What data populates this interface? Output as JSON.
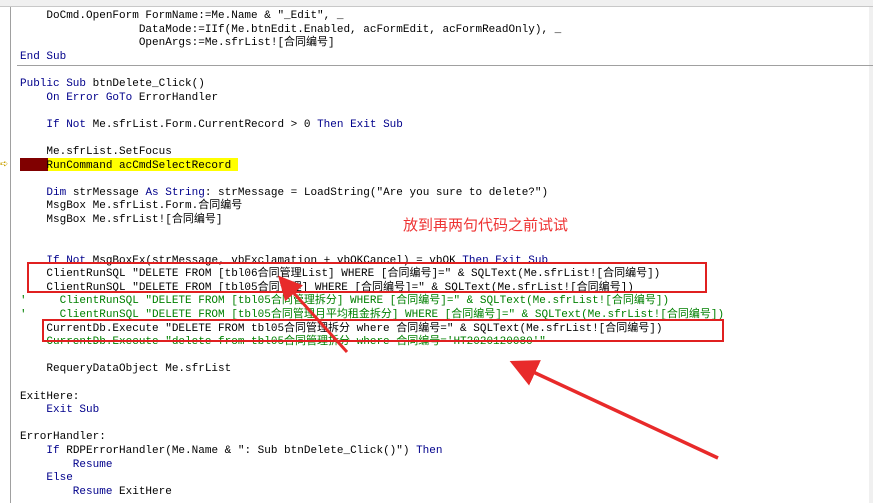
{
  "editor": {
    "lines": [
      [
        {
          "t": "    DoCmd.OpenForm FormName:=Me.Name & \"_Edit\", _",
          "c": "n"
        }
      ],
      [
        {
          "t": "                  DataMode:=IIf(Me.btnEdit.Enabled, acFormEdit, acFormReadOnly), _",
          "c": "n"
        }
      ],
      [
        {
          "t": "                  OpenArgs:=Me.sfrList![合同编号]",
          "c": "n"
        }
      ],
      [
        {
          "t": "End Sub",
          "c": "k"
        }
      ],
      [],
      [
        {
          "t": "Public Sub ",
          "c": "k"
        },
        {
          "t": "btnDelete_Click()",
          "c": "n"
        }
      ],
      [
        {
          "t": "    On Error GoTo ",
          "c": "k"
        },
        {
          "t": "ErrorHandler",
          "c": "n"
        }
      ],
      [],
      [
        {
          "t": "    If Not ",
          "c": "k"
        },
        {
          "t": "Me.sfrList.Form.CurrentRecord > 0 ",
          "c": "n"
        },
        {
          "t": "Then Exit Sub",
          "c": "k"
        }
      ],
      [],
      [
        {
          "t": "    Me.sfrList.SetFocus",
          "c": "n"
        }
      ],
      [
        {
          "t": "    RunCommand acCmdSelectRecord",
          "c": "n"
        }
      ],
      [],
      [
        {
          "t": "    Dim ",
          "c": "k"
        },
        {
          "t": "strMessage ",
          "c": "n"
        },
        {
          "t": "As String",
          "c": "k"
        },
        {
          "t": ": strMessage = LoadString(\"Are you sure to delete?\")",
          "c": "n"
        }
      ],
      [
        {
          "t": "    MsgBox Me.sfrList.Form.合同编号",
          "c": "n"
        }
      ],
      [
        {
          "t": "    MsgBox Me.sfrList![合同编号]",
          "c": "n"
        }
      ],
      [],
      [],
      [
        {
          "t": "    If Not ",
          "c": "k"
        },
        {
          "t": "MsgBoxEx(strMessage, vbExclamation + vbOKCancel) = vbOK ",
          "c": "n"
        },
        {
          "t": "Then Exit Sub",
          "c": "k"
        }
      ],
      [
        {
          "t": "    ClientRunSQL \"DELETE FROM [tbl06合同管理List] WHERE [合同编号]=\" & SQLText(Me.sfrList![合同编号])",
          "c": "n"
        }
      ],
      [
        {
          "t": "    ClientRunSQL \"DELETE FROM [tbl05合同管理] WHERE [合同编号]=\" & SQLText(Me.sfrList![合同编号])",
          "c": "n"
        }
      ],
      [
        {
          "t": "'     ClientRunSQL \"DELETE FROM [tbl05合同管理拆分] WHERE [合同编号]=\" & SQLText(Me.sfrList![合同编号])",
          "c": "c"
        }
      ],
      [
        {
          "t": "'     ClientRunSQL \"DELETE FROM [tbl05合同管理月平均租金拆分] WHERE [合同编号]=\" & SQLText(Me.sfrList![合同编号])",
          "c": "c"
        }
      ],
      [
        {
          "t": "    CurrentDb.Execute \"DELETE FROM tbl05合同管理拆分 where 合同编号=\" & SQLText(Me.sfrList![合同编号])",
          "c": "n"
        }
      ],
      [
        {
          "t": "   'CurrentDb.Execute \"delete from tbl05合同管理拆分 where 合同编号='HT2020120080'\"",
          "c": "c"
        }
      ],
      [],
      [
        {
          "t": "    RequeryDataObject Me.sfrList",
          "c": "n"
        }
      ],
      [],
      [
        {
          "t": "ExitHere:",
          "c": "n"
        }
      ],
      [
        {
          "t": "    Exit Sub",
          "c": "k"
        }
      ],
      [],
      [
        {
          "t": "ErrorHandler:",
          "c": "n"
        }
      ],
      [
        {
          "t": "    If ",
          "c": "k"
        },
        {
          "t": "RDPErrorHandler(Me.Name & \": Sub btnDelete_Click()\") ",
          "c": "n"
        },
        {
          "t": "Then",
          "c": "k"
        }
      ],
      [
        {
          "t": "        Resume",
          "c": "k"
        }
      ],
      [
        {
          "t": "    Else",
          "c": "k"
        }
      ],
      [
        {
          "t": "        Resume ",
          "c": "k"
        },
        {
          "t": "ExitHere",
          "c": "n"
        }
      ]
    ]
  },
  "annotation": {
    "note": "放到再两句代码之前试试",
    "color": "#ee3333"
  },
  "colors": {
    "keyword": "#00008b",
    "comment": "#008000",
    "breakpoint": "#800000",
    "current_line": "#ffff00"
  }
}
